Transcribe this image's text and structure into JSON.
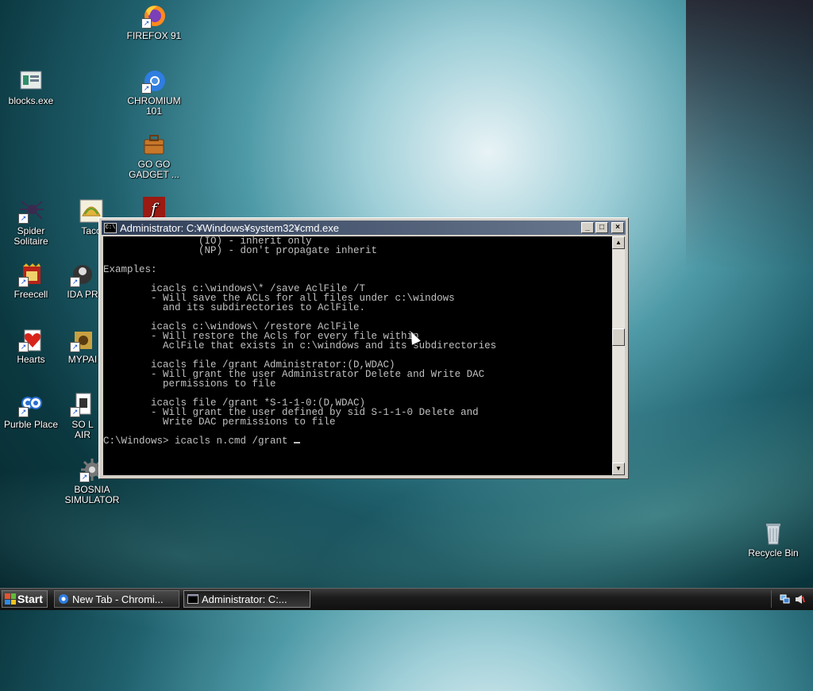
{
  "desktop": {
    "icons": [
      {
        "label": "FIREFOX 91",
        "icon": "firefox-icon"
      },
      {
        "label": "blocks.exe",
        "icon": "blocks-icon"
      },
      {
        "label": "CHROMIUM 101",
        "icon": "chromium-icon"
      },
      {
        "label": "GO GO GADGET ...",
        "icon": "gadget-icon"
      },
      {
        "label": "Spider Solitaire",
        "icon": "spider-icon"
      },
      {
        "label": "Taco",
        "icon": "taco-icon"
      },
      {
        "label": "Freecell",
        "icon": "freecell-icon"
      },
      {
        "label": "IDA PR",
        "icon": "ida-icon"
      },
      {
        "label": "Hearts",
        "icon": "hearts-icon"
      },
      {
        "label": "MYPAI",
        "icon": "mypai-icon"
      },
      {
        "label": "Purble Place",
        "icon": "purble-icon"
      },
      {
        "label": "SO L AIR",
        "icon": "so-icon"
      },
      {
        "label": "BOSNIA SIMULATOR",
        "icon": "bosnia-icon"
      },
      {
        "label": "Recycle Bin",
        "icon": "recycle-bin-icon"
      }
    ]
  },
  "cmd_window": {
    "title": "Administrator: C:¥Windows¥system32¥cmd.exe",
    "lines": [
      "                (IO) - inherit only",
      "                (NP) - don't propagate inherit",
      "",
      "Examples:",
      "",
      "        icacls c:\\windows\\* /save AclFile /T",
      "        - Will save the ACLs for all files under c:\\windows",
      "          and its subdirectories to AclFile.",
      "",
      "        icacls c:\\windows\\ /restore AclFile",
      "        - Will restore the Acls for every file within",
      "          AclFile that exists in c:\\windows and its subdirectories",
      "",
      "        icacls file /grant Administrator:(D,WDAC)",
      "        - Will grant the user Administrator Delete and Write DAC",
      "          permissions to file",
      "",
      "        icacls file /grant *S-1-1-0:(D,WDAC)",
      "        - Will grant the user defined by sid S-1-1-0 Delete and",
      "          Write DAC permissions to file",
      ""
    ],
    "prompt": "C:\\Windows> icacls n.cmd /grant "
  },
  "taskbar": {
    "start_label": "Start",
    "tasks": [
      {
        "label": "New Tab - Chromi...",
        "active": false
      },
      {
        "label": "Administrator: C:...",
        "active": true
      }
    ]
  },
  "colors": {
    "console_bg": "#000000",
    "console_fg": "#c0c0c0",
    "titlebar": "#2f3e58"
  }
}
